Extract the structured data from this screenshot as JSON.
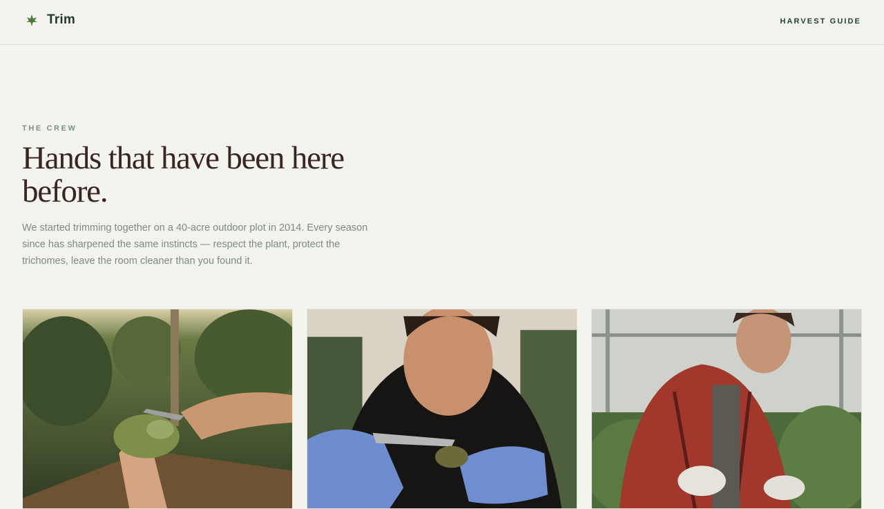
{
  "header": {
    "brand_name": "Trim",
    "brand_icon": "leaf-icon",
    "nav_link": "HARVEST GUIDE"
  },
  "hero": {
    "eyebrow": "THE CREW",
    "headline": "Hands that have been here before.",
    "lede": "We started trimming together on a 40-acre outdoor plot in 2014. Every season since has sharpened the same instincts — respect the plant, protect the trichomes, leave the room cleaner than you found it."
  },
  "crew_cards": [
    {
      "photo": "hands trimming a bud with shears in an outdoor garden"
    },
    {
      "photo": "woman in blue gloves trimming a bud"
    },
    {
      "photo": "man in plaid shirt working in a greenhouse"
    }
  ],
  "colors": {
    "background": "#f4f4ee",
    "brand_green": "#1f3b2b",
    "headline": "#3a2522",
    "muted": "#7b8c7f"
  }
}
